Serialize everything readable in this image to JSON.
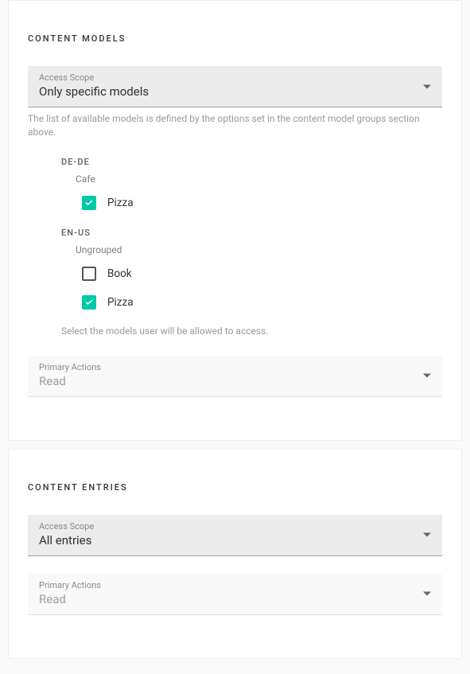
{
  "content_models": {
    "title": "CONTENT MODELS",
    "access_scope": {
      "label": "Access Scope",
      "value": "Only specific models"
    },
    "helper": "The list of available models is defined by the options set in the content model groups section above.",
    "locales": [
      {
        "code": "DE-DE",
        "groups": [
          {
            "name": "Cafe",
            "items": [
              {
                "label": "Pizza",
                "checked": true
              }
            ]
          }
        ]
      },
      {
        "code": "EN-US",
        "groups": [
          {
            "name": "Ungrouped",
            "items": [
              {
                "label": "Book",
                "checked": false
              },
              {
                "label": "Pizza",
                "checked": true
              }
            ]
          }
        ]
      }
    ],
    "tree_helper": "Select the models user will be allowed to access.",
    "primary_actions": {
      "label": "Primary Actions",
      "value": "Read"
    }
  },
  "content_entries": {
    "title": "CONTENT ENTRIES",
    "access_scope": {
      "label": "Access Scope",
      "value": "All entries"
    },
    "primary_actions": {
      "label": "Primary Actions",
      "value": "Read"
    }
  }
}
